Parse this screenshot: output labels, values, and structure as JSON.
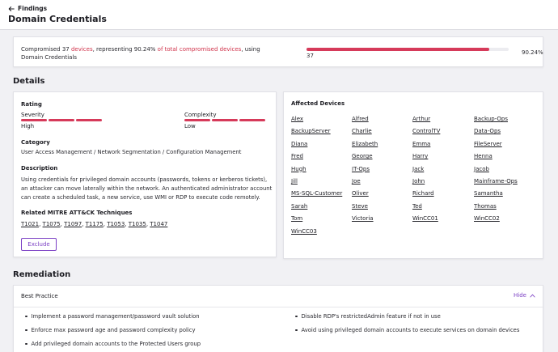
{
  "header": {
    "back_label": "Findings",
    "title": "Domain Credentials"
  },
  "summary": {
    "text_part1": "Compromised 37 ",
    "devices_word": "devices",
    "text_part2": ", representing 90.24% ",
    "total_link": "of total compromised devices",
    "text_part3": ", using Domain Credentials",
    "count": "37",
    "percent_label": "90.24%",
    "progress_fraction": 0.9024,
    "highlight_color": "#d0324a",
    "bar_color": "#d63a5a"
  },
  "details": {
    "section_title": "Details",
    "rating_label": "Rating",
    "severity_label": "Severity",
    "severity_value": "High",
    "complexity_label": "Complexity",
    "complexity_value": "Low",
    "category_label": "Category",
    "category_value": "User Access Management / Network Segmentation / Configuration Management",
    "description_label": "Description",
    "description_text": "Using credentials for privileged domain accounts (passwords, tokens or kerberos tickets), an attacker can move laterally within the network. An authenticated administrator account can create a scheduled task, a new service, use WMI or RDP to execute code remotely.",
    "mitre_label": "Related MITRE ATT&CK Techniques",
    "techniques": [
      "T1021",
      "T1075",
      "T1097",
      "T1175",
      "T1053",
      "T1035",
      "T1047"
    ],
    "exclude_label": "Exclude",
    "accent_color": "#7b3fc4"
  },
  "affected_devices": {
    "title": "Affected Devices",
    "devices": [
      "Alex",
      "Alfred",
      "Arthur",
      "Backup-Ops",
      "BackupServer",
      "Charlie",
      "ControlTV",
      "Data-Ops",
      "Diana",
      "Elizabeth",
      "Emma",
      "FileServer",
      "Fred",
      "George",
      "Harry",
      "Henna",
      "Hugh",
      "IT-Ops",
      "Jack",
      "Jacob",
      "Jill",
      "Joe",
      "John",
      "Mainframe-Ops",
      "MS-SQL-Customer",
      "Oliver",
      "Richard",
      "Samantha",
      "Sarah",
      "Steve",
      "Ted",
      "Thomas",
      "Tom",
      "Victoria",
      "WinCC01",
      "WinCC02",
      "WinCC03"
    ]
  },
  "remediation": {
    "section_title": "Remediation",
    "best_practice_label": "Best Practice",
    "hide_label": "Hide",
    "left_items": [
      "Implement a password management/password vault solution",
      "Enforce max password age and password complexity policy",
      "Add privileged domain accounts to the Protected Users group"
    ],
    "right_items": [
      "Disable RDP's restrictedAdmin feature if not in use",
      "Avoid using privileged domain accounts to execute services on domain devices"
    ]
  }
}
